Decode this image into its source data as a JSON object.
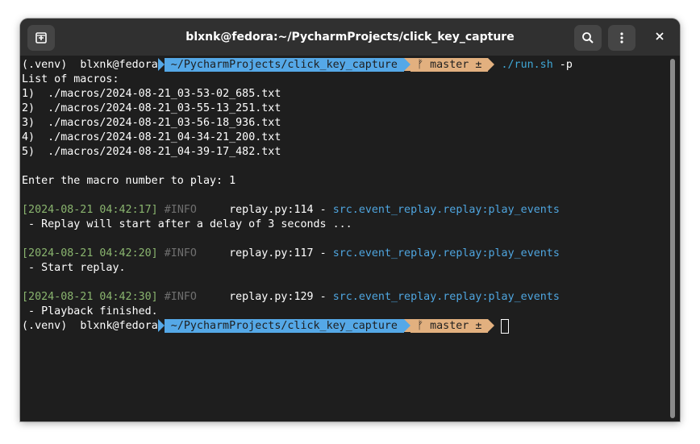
{
  "window": {
    "title": "blxnk@fedora:~/PycharmProjects/click_key_capture"
  },
  "titlebar": {
    "icons": [
      "new-tab-icon",
      "search-icon",
      "menu-kebab-icon",
      "close-icon"
    ]
  },
  "prompt": {
    "venv": "(.venv)",
    "user": "blxnk@fedora",
    "path": "~/PycharmProjects/click_key_capture",
    "git_branch": "ᚠ master ±",
    "command": "./run.sh",
    "args": "-p"
  },
  "output": {
    "macros_header": "List of macros:",
    "macros": [
      {
        "num": "1)",
        "path": "./macros/2024-08-21_03-53-02_685.txt"
      },
      {
        "num": "2)",
        "path": "./macros/2024-08-21_03-55-13_251.txt"
      },
      {
        "num": "3)",
        "path": "./macros/2024-08-21_03-56-18_936.txt"
      },
      {
        "num": "4)",
        "path": "./macros/2024-08-21_04-34-21_200.txt"
      },
      {
        "num": "5)",
        "path": "./macros/2024-08-21_04-39-17_482.txt"
      }
    ],
    "input_prompt": "Enter the macro number to play: 1",
    "logs": [
      {
        "timestamp": "[2024-08-21 04:42:17]",
        "level": "#INFO",
        "location": "replay.py:114",
        "separator": "-",
        "module": "src.event_replay.replay:play_events",
        "message": " - Replay will start after a delay of 3 seconds ..."
      },
      {
        "timestamp": "[2024-08-21 04:42:20]",
        "level": "#INFO",
        "location": "replay.py:117",
        "separator": "-",
        "module": "src.event_replay.replay:play_events",
        "message": " - Start replay."
      },
      {
        "timestamp": "[2024-08-21 04:42:30]",
        "level": "#INFO",
        "location": "replay.py:129",
        "separator": "-",
        "module": "src.event_replay.replay:play_events",
        "message": " - Playback finished."
      }
    ]
  },
  "colors": {
    "background": "#1e1e1e",
    "titlebar": "#303030",
    "path_segment": "#55a8e7",
    "git_segment": "#e2b07f",
    "timestamp": "#8ab56f",
    "level": "#6f6f6f",
    "module": "#4fa6e0"
  }
}
